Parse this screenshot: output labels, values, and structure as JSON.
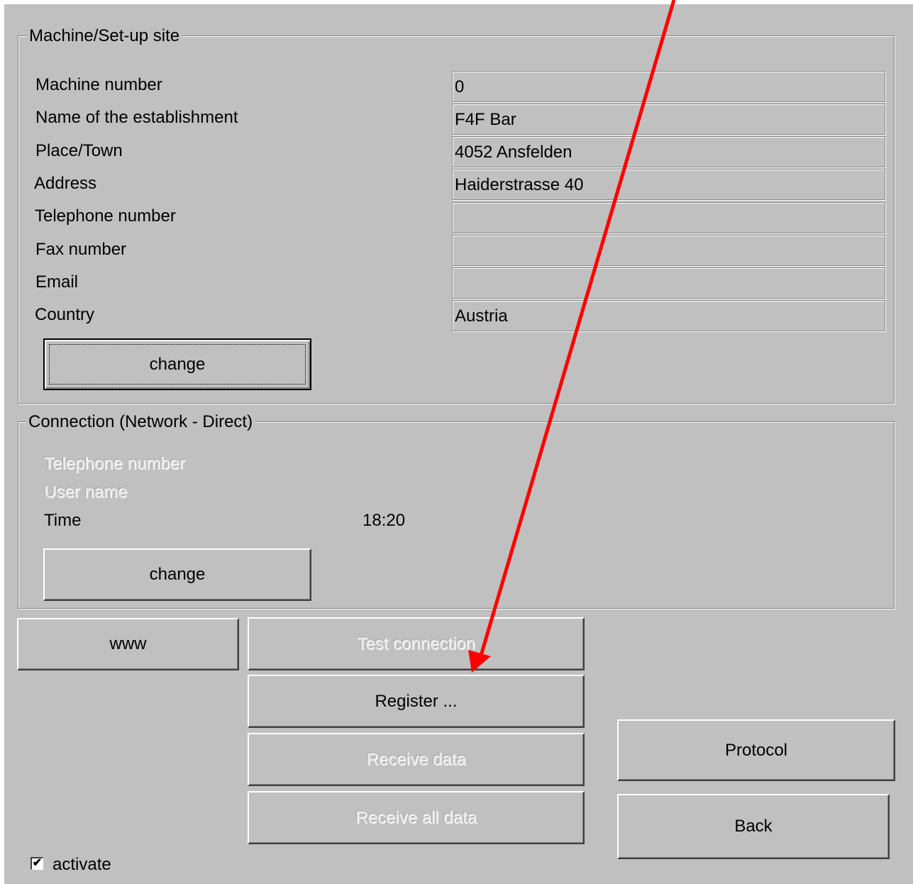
{
  "machine_group": {
    "legend": "Machine/Set-up site",
    "rows": [
      {
        "label": "Machine number",
        "value": "0"
      },
      {
        "label": "Name of the establishment",
        "value": "F4F Bar"
      },
      {
        "label": "Place/Town",
        "value": "4052 Ansfelden"
      },
      {
        "label": "Address",
        "value": "Haiderstrasse 40"
      },
      {
        "label": "Telephone number",
        "value": ""
      },
      {
        "label": "Fax number",
        "value": ""
      },
      {
        "label": "Email",
        "value": ""
      },
      {
        "label": "Country",
        "value": "Austria"
      }
    ],
    "change_label": "change"
  },
  "connection_group": {
    "legend": "Connection (Network - Direct)",
    "telephone_label": "Telephone number",
    "user_label": "User name",
    "time_label": "Time",
    "time_value": "18:20",
    "change_label": "change"
  },
  "buttons": {
    "www": "www",
    "test_connection": "Test connection",
    "register": "Register ...",
    "receive_data": "Receive data",
    "receive_all_data": "Receive all data",
    "protocol": "Protocol",
    "back": "Back"
  },
  "activate": {
    "label": "activate",
    "checked": true
  },
  "annotation": {
    "arrow_color": "#ff0000"
  }
}
